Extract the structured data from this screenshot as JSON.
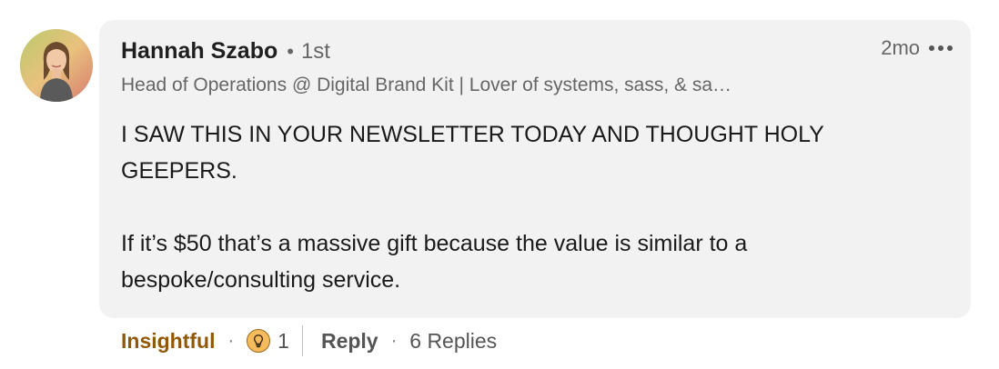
{
  "comment": {
    "author": {
      "name": "Hannah Szabo",
      "separator": "•",
      "degree": "1st",
      "headline": "Head of Operations @ Digital Brand Kit | Lover of systems, sass, & sa…",
      "avatar_icon": "profile-photo"
    },
    "timestamp": "2mo",
    "more_icon": "ellipsis-icon",
    "body": [
      "I SAW THIS IN YOUR NEWSLETTER TODAY AND THOUGHT HOLY GEEPERS.",
      "If it’s $50 that’s a massive gift because the value is similar to a bespoke/consulting service."
    ]
  },
  "actions": {
    "reaction_label": "Insightful",
    "reaction_color": "#915907",
    "dot": "·",
    "reaction_icon": "lightbulb-icon",
    "reaction_count": "1",
    "reply_label": "Reply",
    "replies_label": "6 Replies"
  }
}
